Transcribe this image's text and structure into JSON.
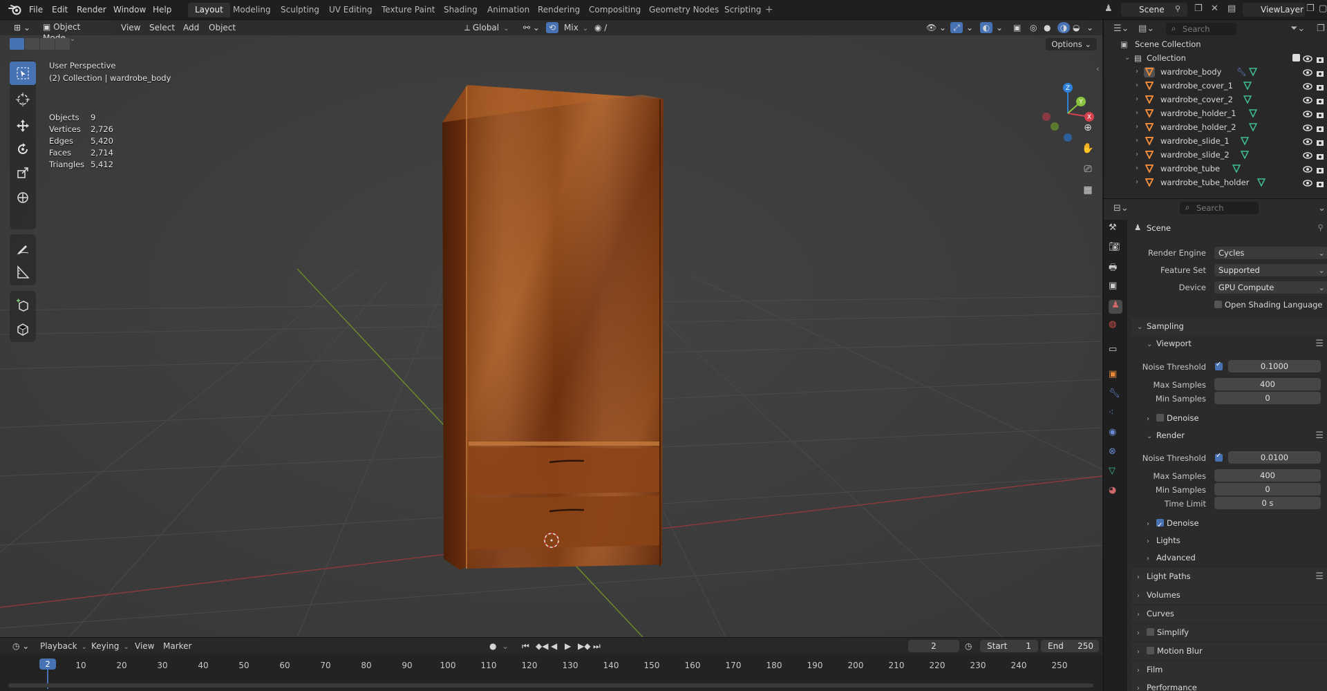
{
  "topbar": {
    "menus": [
      "File",
      "Edit",
      "Render",
      "Window",
      "Help"
    ],
    "workspaces": [
      "Layout",
      "Modeling",
      "Sculpting",
      "UV Editing",
      "Texture Paint",
      "Shading",
      "Animation",
      "Rendering",
      "Compositing",
      "Geometry Nodes",
      "Scripting"
    ],
    "active_workspace": "Layout",
    "add_tab": "+",
    "scene": "Scene",
    "view_layer": "ViewLayer"
  },
  "viewport_header": {
    "mode": "Object Mode",
    "menus": [
      "View",
      "Select",
      "Add",
      "Object"
    ],
    "orientation": "Global",
    "snap_target": "Mix",
    "options": "Options"
  },
  "viewport_overlay": {
    "perspective": "User Perspective",
    "collection_object": "(2) Collection | wardrobe_body",
    "stats": [
      {
        "label": "Objects",
        "value": "9"
      },
      {
        "label": "Vertices",
        "value": "2,726"
      },
      {
        "label": "Edges",
        "value": "5,420"
      },
      {
        "label": "Faces",
        "value": "2,714"
      },
      {
        "label": "Triangles",
        "value": "5,412"
      }
    ],
    "gizmo_axes": {
      "x": "X",
      "y": "Y",
      "z": "Z"
    }
  },
  "timeline": {
    "menus": [
      "Playback",
      "Keying",
      "View",
      "Marker"
    ],
    "current_frame": "2",
    "start_label": "Start",
    "start_value": "1",
    "end_label": "End",
    "end_value": "250",
    "ruler_labels": [
      "10",
      "20",
      "30",
      "40",
      "50",
      "60",
      "70",
      "80",
      "90",
      "100",
      "110",
      "120",
      "130",
      "140",
      "150",
      "160",
      "170",
      "180",
      "190",
      "200",
      "210",
      "220",
      "230",
      "240",
      "250"
    ],
    "playhead_label": "2"
  },
  "outliner": {
    "search_placeholder": "Search",
    "scene_collection": "Scene Collection",
    "collection": "Collection",
    "items": [
      "wardrobe_body",
      "wardrobe_cover_1",
      "wardrobe_cover_2",
      "wardrobe_holder_1",
      "wardrobe_holder_2",
      "wardrobe_slide_1",
      "wardrobe_slide_2",
      "wardrobe_tube",
      "wardrobe_tube_holder"
    ]
  },
  "properties": {
    "search_placeholder": "Search",
    "context": "Scene",
    "render_engine_label": "Render Engine",
    "render_engine": "Cycles",
    "feature_set_label": "Feature Set",
    "feature_set": "Supported",
    "device_label": "Device",
    "device": "GPU Compute",
    "osl_label": "Open Shading Language",
    "sampling": "Sampling",
    "viewport": "Viewport",
    "noise_threshold_label": "Noise Threshold",
    "viewport_noise_threshold": "0.1000",
    "max_samples_label": "Max Samples",
    "viewport_max_samples": "400",
    "min_samples_label": "Min Samples",
    "viewport_min_samples": "0",
    "denoise": "Denoise",
    "render": "Render",
    "render_noise_threshold": "0.0100",
    "render_max_samples": "400",
    "render_min_samples": "0",
    "time_limit_label": "Time Limit",
    "time_limit": "0 s",
    "lights": "Lights",
    "advanced": "Advanced",
    "light_paths": "Light Paths",
    "volumes": "Volumes",
    "curves": "Curves",
    "simplify": "Simplify",
    "motion_blur": "Motion Blur",
    "film": "Film",
    "performance": "Performance"
  },
  "colors": {
    "accent": "#4772b3",
    "object_orange": "#e8893a",
    "mesh_green": "#3fbf8f",
    "x_axis": "#d5404f",
    "y_axis": "#8ac33d",
    "z_axis": "#2e80d8"
  }
}
